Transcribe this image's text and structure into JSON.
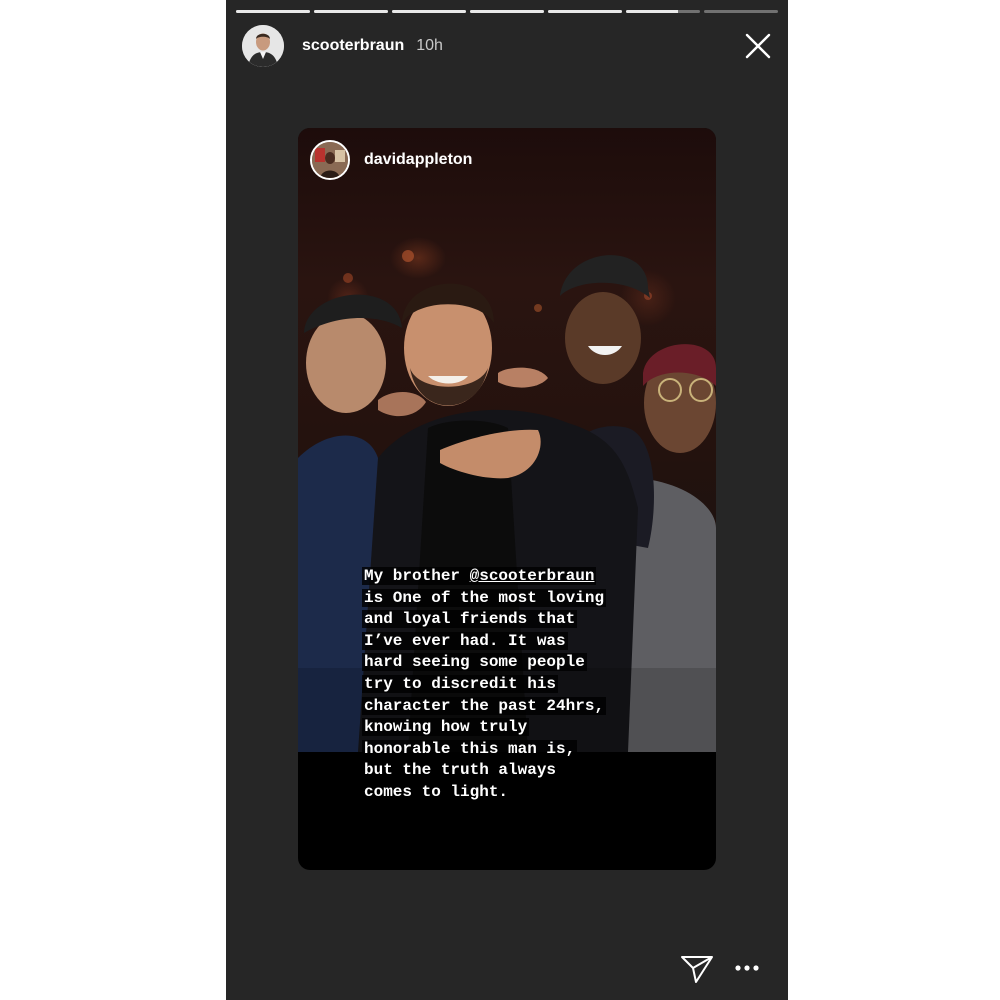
{
  "story": {
    "segments": [
      1,
      1,
      1,
      1,
      1,
      0.7,
      0
    ],
    "username": "scooterbraun",
    "time": "10h"
  },
  "shared_post": {
    "username": "davidappleton",
    "caption_lines": [
      {
        "pre": "My brother ",
        "mention": "@scooterbraun",
        "post": ""
      },
      {
        "pre": "is One of the most loving",
        "mention": "",
        "post": ""
      },
      {
        "pre": "and loyal friends that",
        "mention": "",
        "post": ""
      },
      {
        "pre": "I’ve ever had. It was",
        "mention": "",
        "post": ""
      },
      {
        "pre": "hard seeing some people",
        "mention": "",
        "post": ""
      },
      {
        "pre": "try to discredit his",
        "mention": "",
        "post": ""
      },
      {
        "pre": "character the past 24hrs,",
        "mention": "",
        "post": ""
      },
      {
        "pre": "knowing how truly",
        "mention": "",
        "post": ""
      },
      {
        "pre": "honorable this man is,",
        "mention": "",
        "post": ""
      },
      {
        "pre": "but the truth always",
        "mention": "",
        "post": ""
      },
      {
        "pre": "comes to light.",
        "mention": "",
        "post": ""
      }
    ]
  },
  "icons": {
    "close": "close-icon",
    "send": "paper-plane-icon",
    "more": "more-dots-icon"
  },
  "colors": {
    "background": "#262626",
    "progress_done": "#e9e9e9",
    "progress_pending": "rgba(255,255,255,0.35)"
  }
}
